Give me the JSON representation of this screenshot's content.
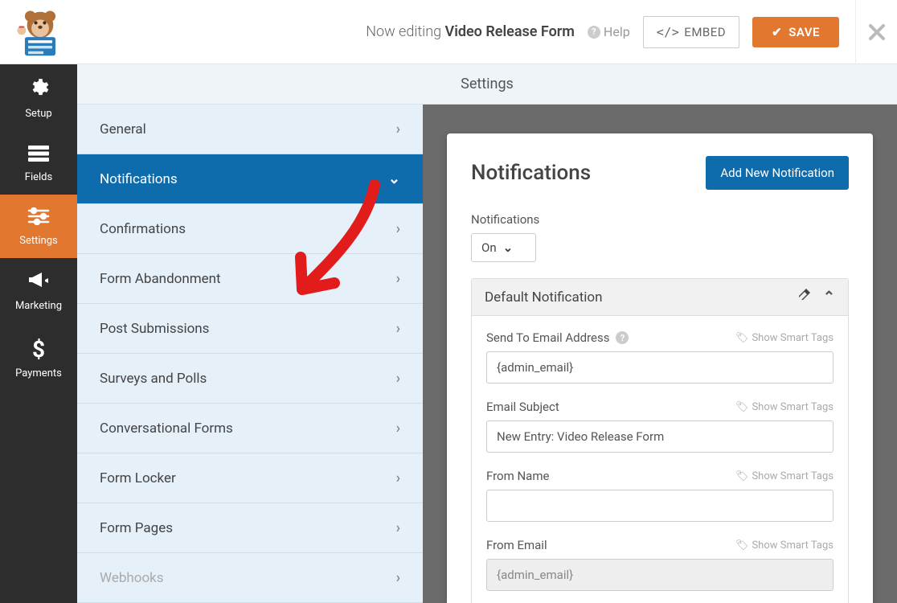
{
  "header": {
    "editing_prefix": "Now editing ",
    "form_name": "Video Release Form",
    "help_label": "Help",
    "embed_label": "EMBED",
    "save_label": "SAVE"
  },
  "iconbar": {
    "items": [
      {
        "label": "Setup"
      },
      {
        "label": "Fields"
      },
      {
        "label": "Settings"
      },
      {
        "label": "Marketing"
      },
      {
        "label": "Payments"
      }
    ]
  },
  "panel_title": "Settings",
  "settings_menu": {
    "items": [
      {
        "label": "General"
      },
      {
        "label": "Notifications"
      },
      {
        "label": "Confirmations"
      },
      {
        "label": "Form Abandonment"
      },
      {
        "label": "Post Submissions"
      },
      {
        "label": "Surveys and Polls"
      },
      {
        "label": "Conversational Forms"
      },
      {
        "label": "Form Locker"
      },
      {
        "label": "Form Pages"
      },
      {
        "label": "Webhooks"
      }
    ]
  },
  "notifications": {
    "heading": "Notifications",
    "add_button": "Add New Notification",
    "toggle_label": "Notifications",
    "toggle_value": "On",
    "default_title": "Default Notification",
    "smart_tags_label": "Show Smart Tags",
    "fields": {
      "send_to_label": "Send To Email Address",
      "send_to_value": "{admin_email}",
      "subject_label": "Email Subject",
      "subject_value": "New Entry: Video Release Form",
      "from_name_label": "From Name",
      "from_name_value": "",
      "from_email_label": "From Email",
      "from_email_value": "{admin_email}"
    }
  }
}
